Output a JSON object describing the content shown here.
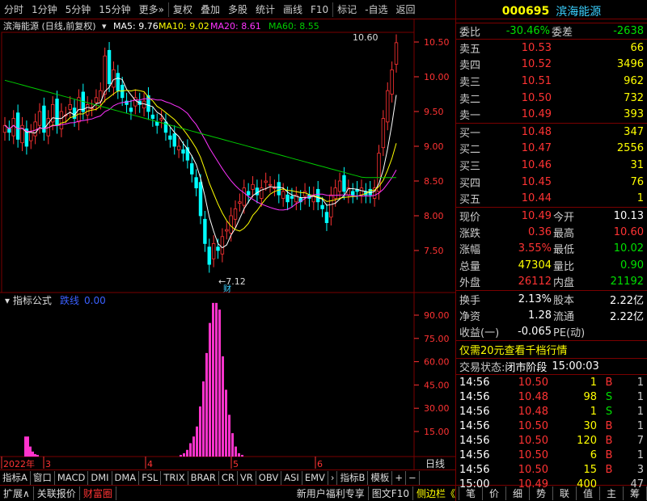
{
  "toolbar": {
    "items": [
      "分时",
      "1分钟",
      "5分钟",
      "15分钟",
      "更多",
      "复权",
      "叠加",
      "多股",
      "统计",
      "画线",
      "F10",
      "标记",
      "-自选",
      "返回"
    ]
  },
  "chart": {
    "stock_name": "滨海能源",
    "adjust": "(日线,前复权)",
    "ma5": "MA5: 9.76",
    "ma10": "MA10: 9.02",
    "ma20": "MA20: 8.61",
    "ma60": "MA60: 8.55",
    "high_label": "10.60",
    "low_label": "7.12",
    "fin_mark": "财",
    "y_ticks": [
      "10.50",
      "10.00",
      "9.50",
      "9.00",
      "8.50",
      "8.00",
      "7.50"
    ],
    "colors": {
      "ma5": "#ffffff",
      "ma10": "#ffff00",
      "ma20": "#ff33ff",
      "ma60": "#00cc00",
      "up": "#ff3333",
      "down": "#00ffff"
    }
  },
  "indicator": {
    "title": "指标公式",
    "name": "跌线",
    "value": "0.00",
    "y_ticks": [
      "90.00",
      "75.00",
      "60.00",
      "45.00",
      "30.00",
      "15.00"
    ]
  },
  "xaxis": {
    "labels": [
      "2022年",
      "3",
      "4",
      "5",
      "6"
    ],
    "right_label": "日线"
  },
  "tabs": [
    "指标A",
    "窗口",
    "MACD",
    "DMI",
    "DMA",
    "FSL",
    "TRIX",
    "BRAR",
    "CR",
    "VR",
    "OBV",
    "ASI",
    "EMV",
    "›",
    "指标B",
    "模板",
    "+",
    "−"
  ],
  "bottom": {
    "items": [
      "扩展∧",
      "关联报价",
      "财富圈"
    ],
    "right_items": [
      "新用户福利专享",
      "图文F10",
      "侧边栏《"
    ],
    "right_tabs": [
      "笔",
      "价",
      "细",
      "势",
      "联",
      "值",
      "主",
      "筹"
    ]
  },
  "quote": {
    "code": "000695",
    "name": "滨海能源",
    "weibi_label": "委比",
    "weibi": "-30.46%",
    "weicha_label": "委差",
    "weicha": "-2638",
    "sells": [
      {
        "label": "卖五",
        "price": "10.53",
        "vol": "66"
      },
      {
        "label": "卖四",
        "price": "10.52",
        "vol": "3496"
      },
      {
        "label": "卖三",
        "price": "10.51",
        "vol": "962"
      },
      {
        "label": "卖二",
        "price": "10.50",
        "vol": "732"
      },
      {
        "label": "卖一",
        "price": "10.49",
        "vol": "393"
      }
    ],
    "buys": [
      {
        "label": "买一",
        "price": "10.48",
        "vol": "347"
      },
      {
        "label": "买二",
        "price": "10.47",
        "vol": "2556"
      },
      {
        "label": "买三",
        "price": "10.46",
        "vol": "31"
      },
      {
        "label": "买四",
        "price": "10.45",
        "vol": "76"
      },
      {
        "label": "买五",
        "price": "10.44",
        "vol": "1"
      }
    ],
    "stats": [
      [
        {
          "l": "现价",
          "v": "10.49",
          "c": "red"
        },
        {
          "l": "今开",
          "v": "10.13",
          "c": "wht"
        }
      ],
      [
        {
          "l": "涨跌",
          "v": "0.36",
          "c": "red"
        },
        {
          "l": "最高",
          "v": "10.60",
          "c": "red"
        }
      ],
      [
        {
          "l": "涨幅",
          "v": "3.55%",
          "c": "red"
        },
        {
          "l": "最低",
          "v": "10.02",
          "c": "grn"
        }
      ],
      [
        {
          "l": "总量",
          "v": "47304",
          "c": "yel"
        },
        {
          "l": "量比",
          "v": "0.90",
          "c": "grn"
        }
      ],
      [
        {
          "l": "外盘",
          "v": "26112",
          "c": "red"
        },
        {
          "l": "内盘",
          "v": "21192",
          "c": "grn"
        }
      ]
    ],
    "stats2": [
      [
        {
          "l": "换手",
          "v": "2.13%",
          "c": "wht"
        },
        {
          "l": "股本",
          "v": "2.22亿",
          "c": "wht"
        }
      ],
      [
        {
          "l": "净资",
          "v": "1.28",
          "c": "wht"
        },
        {
          "l": "流通",
          "v": "2.22亿",
          "c": "wht"
        }
      ],
      [
        {
          "l": "收益(一)",
          "v": "-0.065",
          "c": "wht"
        },
        {
          "l": "PE(动)",
          "v": "",
          "c": "wht"
        }
      ]
    ],
    "promo": "仅需20元查看千档行情",
    "trade_state_label": "交易状态:",
    "trade_state": "闭市阶段",
    "trade_time": "15:00:03",
    "ticks": [
      {
        "t": "14:56",
        "p": "10.50",
        "v": "1",
        "f": "B",
        "n": "1"
      },
      {
        "t": "14:56",
        "p": "10.48",
        "v": "98",
        "f": "S",
        "n": "1"
      },
      {
        "t": "14:56",
        "p": "10.48",
        "v": "1",
        "f": "S",
        "n": "1"
      },
      {
        "t": "14:56",
        "p": "10.50",
        "v": "30",
        "f": "B",
        "n": "1"
      },
      {
        "t": "14:56",
        "p": "10.50",
        "v": "120",
        "f": "B",
        "n": "7"
      },
      {
        "t": "14:56",
        "p": "10.50",
        "v": "6",
        "f": "B",
        "n": "1"
      },
      {
        "t": "14:56",
        "p": "10.50",
        "v": "15",
        "f": "B",
        "n": "3"
      },
      {
        "t": "15:00",
        "p": "10.49",
        "v": "400",
        "f": "",
        "n": "47"
      }
    ]
  }
}
